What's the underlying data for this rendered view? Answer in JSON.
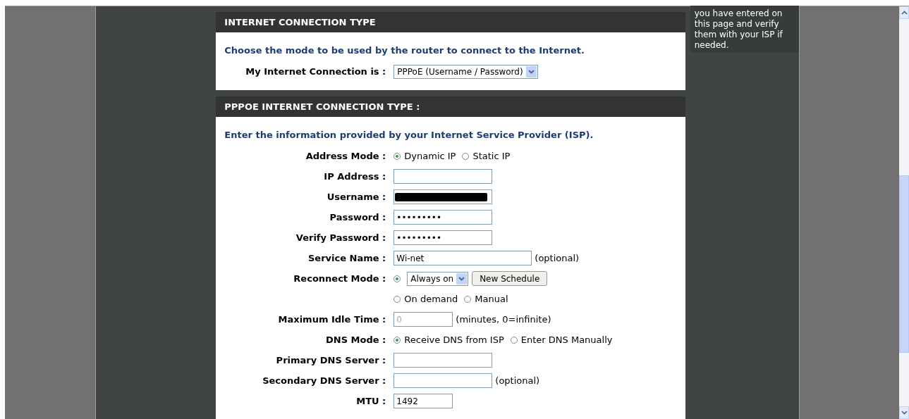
{
  "help_text": "you have entered on this page and verify them with your ISP if needed.",
  "sections": [
    {
      "title": "INTERNET CONNECTION TYPE",
      "intro": "Choose the mode to be used by the router to connect to the Internet.",
      "rows": [
        {
          "label": "My Internet Connection is :",
          "items": [
            {
              "kind": "select",
              "value": "PPPoE (Username / Password)"
            }
          ]
        }
      ]
    },
    {
      "title": "PPPOE INTERNET CONNECTION TYPE :",
      "intro": "Enter the information provided by your Internet Service Provider (ISP).",
      "rows": [
        {
          "label": "Address Mode :",
          "items": [
            {
              "kind": "radio",
              "label": "Dynamic IP",
              "selected": true
            },
            {
              "kind": "radio",
              "label": "Static IP",
              "selected": false
            }
          ]
        },
        {
          "label": "IP Address :",
          "items": [
            {
              "kind": "field"
            }
          ]
        },
        {
          "label": "Username :",
          "items": [
            {
              "kind": "redacted"
            }
          ]
        },
        {
          "label": "Password :",
          "items": [
            {
              "kind": "field",
              "value": "•••••••••"
            }
          ]
        },
        {
          "label": "Verify Password :",
          "items": [
            {
              "kind": "field",
              "value": "•••••••••"
            }
          ]
        },
        {
          "label": "Service Name :",
          "items": [
            {
              "kind": "wide_field",
              "value": "Wi-net"
            },
            {
              "kind": "note",
              "text": "(optional)"
            }
          ]
        },
        {
          "label": "Reconnect Mode :",
          "items": [
            {
              "kind": "radio",
              "selected": true
            },
            {
              "kind": "select",
              "value": "Always on"
            },
            {
              "kind": "button",
              "label": "New Schedule"
            }
          ]
        },
        {
          "label": "",
          "items": [
            {
              "kind": "radio",
              "label": "On demand",
              "selected": false
            },
            {
              "kind": "radio",
              "label": "Manual",
              "selected": false
            }
          ]
        },
        {
          "label": "Maximum Idle Time :",
          "items": [
            {
              "kind": "short_field",
              "value": "0",
              "disabled": true
            },
            {
              "kind": "note",
              "text": "(minutes, 0=infinite)"
            }
          ]
        },
        {
          "label": "DNS Mode :",
          "items": [
            {
              "kind": "radio",
              "label": "Receive DNS from ISP",
              "selected": true
            },
            {
              "kind": "radio",
              "label": "Enter DNS Manually",
              "selected": false
            }
          ]
        },
        {
          "label": "Primary DNS Server :",
          "items": [
            {
              "kind": "field"
            }
          ]
        },
        {
          "label": "Secondary DNS Server :",
          "items": [
            {
              "kind": "field"
            },
            {
              "kind": "note",
              "text": "(optional)"
            }
          ]
        },
        {
          "label": "MTU :",
          "items": [
            {
              "kind": "short_field",
              "value": "1492"
            }
          ]
        }
      ]
    }
  ]
}
